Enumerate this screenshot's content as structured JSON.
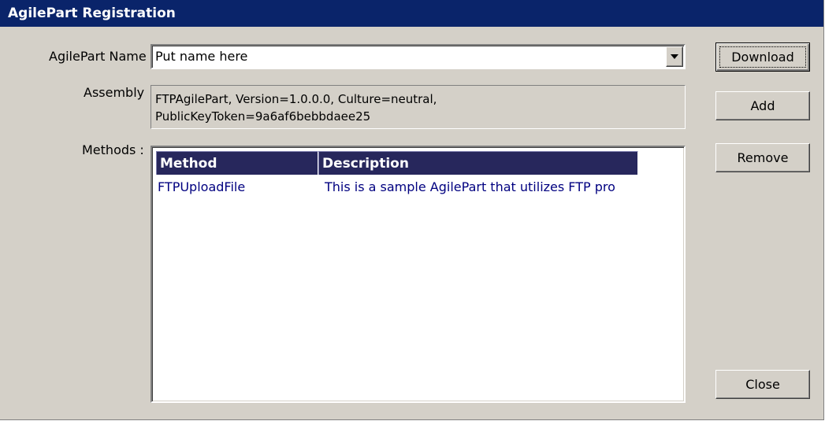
{
  "window": {
    "title": "AgilePart Registration"
  },
  "form": {
    "name_label": "AgilePart Name",
    "name_value": "Put name here",
    "assembly_label": "Assembly",
    "assembly_line1": "FTPAgilePart, Version=1.0.0.0, Culture=neutral,",
    "assembly_line2": "PublicKeyToken=9a6af6bebbdaee25",
    "methods_label": "Methods :"
  },
  "methods_table": {
    "columns": [
      "Method",
      "Description"
    ],
    "rows": [
      [
        "FTPUploadFile",
        "This is a sample AgilePart that utilizes FTP pro"
      ]
    ]
  },
  "buttons": {
    "download": "Download",
    "add": "Add",
    "remove": "Remove",
    "close": "Close"
  },
  "colors": {
    "title_bar": "#0a246a",
    "dialog_face": "#d4d0c8",
    "grid_header": "#27275c",
    "grid_text": "#000080"
  },
  "icons": {
    "combo_dropdown": "triangle-down-icon"
  }
}
